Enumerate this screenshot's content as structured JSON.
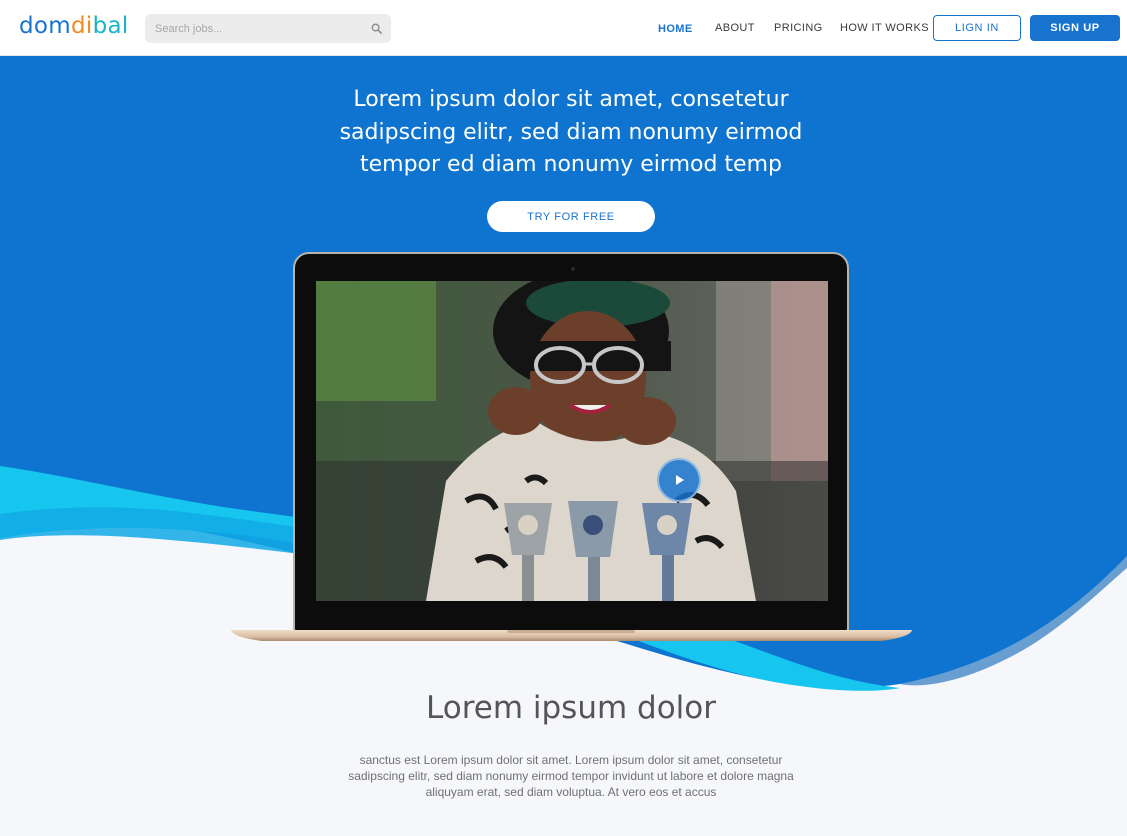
{
  "header": {
    "logo": {
      "part1": "dom",
      "part2": "di",
      "part3": "bal"
    },
    "search": {
      "placeholder": "Search jobs...",
      "value": "",
      "icon": "search-icon"
    },
    "nav": [
      {
        "label": "HOME",
        "active": true
      },
      {
        "label": "ABOUT",
        "active": false
      },
      {
        "label": "PRICING",
        "active": false
      },
      {
        "label": "HOW IT WORKS",
        "active": false
      }
    ],
    "login_label": "LIGN IN",
    "signup_label": "SIGN UP"
  },
  "hero": {
    "title": "Lorem ipsum dolor sit amet, consetetur sadipscing elitr, sed diam nonumy eirmod tempor ed diam nonumy eirmod temp",
    "cta_label": "TRY FOR FREE",
    "video_play_icon": "play-icon"
  },
  "feature": {
    "title": "Lorem ipsum dolor",
    "text": "sanctus est Lorem ipsum dolor sit amet. Lorem ipsum dolor sit amet, consetetur sadipscing elitr, sed diam nonumy eirmod tempor invidunt ut labore et dolore magna aliquyam erat, sed diam voluptua. At vero eos et accus"
  },
  "colors": {
    "brand_blue": "#1873cf",
    "logo_dom": "#1873cf",
    "logo_di": "#f08a24",
    "logo_bal": "#19b4c8",
    "wave_cyan": "#16c6ee",
    "page_bg": "#f6f7fa"
  }
}
